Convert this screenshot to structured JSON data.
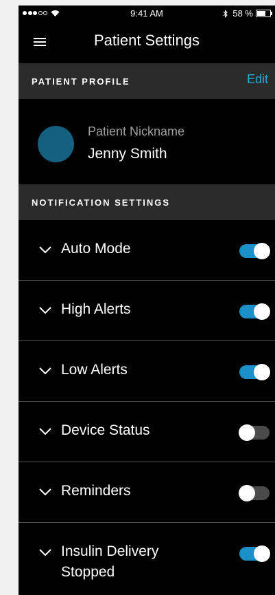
{
  "status_bar": {
    "time": "9:41 AM",
    "battery": "58 %",
    "battery_level": 0.58,
    "signal_icon": "signal-dots-icon",
    "wifi_icon": "wifi-icon",
    "bluetooth_icon": "bluetooth-icon"
  },
  "nav": {
    "menu_icon": "hamburger-menu-icon",
    "title": "Patient Settings"
  },
  "profile_section": {
    "title": "PATIENT PROFILE",
    "edit_label": "Edit",
    "nickname_label": "Patient Nickname",
    "name": "Jenny Smith",
    "avatar_color": "#15607f"
  },
  "notification_section": {
    "title": "NOTIFICATION SETTINGS",
    "items": [
      {
        "label": "Auto Mode",
        "enabled": true
      },
      {
        "label": "High Alerts",
        "enabled": true
      },
      {
        "label": "Low Alerts",
        "enabled": true
      },
      {
        "label": "Device Status",
        "enabled": false
      },
      {
        "label": "Reminders",
        "enabled": false
      },
      {
        "label": "Insulin Delivery Stopped",
        "enabled": true
      }
    ]
  },
  "colors": {
    "accent": "#2aa7d6",
    "toggle_on": "#1c90c9",
    "toggle_off": "#4a4a4a",
    "section_bg": "#2b2b2b",
    "background": "#000000"
  }
}
